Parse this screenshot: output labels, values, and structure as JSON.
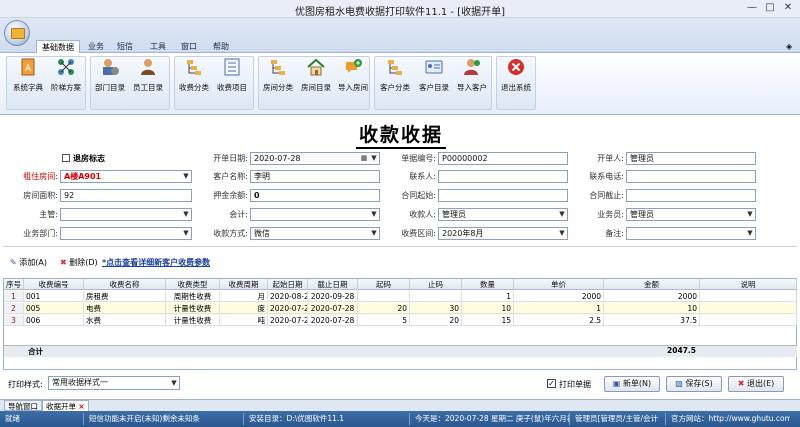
{
  "window": {
    "title": "优图房租水电费收据打印软件11.1 - [收据开单]"
  },
  "ribbon": {
    "tabs": [
      "基础数据",
      "业务",
      "短信",
      "工具",
      "窗口",
      "帮助"
    ],
    "buttons": [
      {
        "label": "系统字典",
        "icon": "dictionary-icon"
      },
      {
        "label": "阶梯方案",
        "icon": "ladder-scheme-icon"
      },
      {
        "label": "部门目录",
        "icon": "department-icon"
      },
      {
        "label": "员工目录",
        "icon": "employee-icon"
      },
      {
        "label": "收费分类",
        "icon": "fee-category-icon"
      },
      {
        "label": "收费项目",
        "icon": "fee-item-icon"
      },
      {
        "label": "房间分类",
        "icon": "room-category-icon"
      },
      {
        "label": "房间目录",
        "icon": "room-list-icon"
      },
      {
        "label": "导入房间",
        "icon": "import-room-icon"
      },
      {
        "label": "客户分类",
        "icon": "customer-category-icon"
      },
      {
        "label": "客户目录",
        "icon": "customer-list-icon"
      },
      {
        "label": "导入客户",
        "icon": "import-customer-icon"
      },
      {
        "label": "退出系统",
        "icon": "exit-icon"
      }
    ]
  },
  "form": {
    "title": "收款收据",
    "checkout_label": "退房标志",
    "fields": {
      "room_label": "租住房间:",
      "room_value": "A楼A901",
      "area_label": "房间面积:",
      "area_value": "92",
      "manager_label": "主管:",
      "manager_value": "",
      "dept_label": "业务部门:",
      "dept_value": "",
      "date_label": "开单日期:",
      "date_value": "2020-07-28",
      "customer_label": "客户名称:",
      "customer_value": "李明",
      "deposit_label": "押金余额:",
      "deposit_value": "0",
      "accountant_label": "会计:",
      "accountant_value": "",
      "paymethod_label": "收款方式:",
      "paymethod_value": "微信",
      "billno_label": "单据编号:",
      "billno_value": "P00000002",
      "contact_label": "联系人:",
      "contact_value": "",
      "contract_start_label": "合同起始:",
      "contract_start_value": "",
      "payee_label": "收款人:",
      "payee_value": "管理员",
      "period_label": "收费区间:",
      "period_value": "2020年8月",
      "opener_label": "开单人:",
      "opener_value": "管理员",
      "phone_label": "联系电话:",
      "phone_value": "",
      "contract_end_label": "合同截止:",
      "contract_end_value": "",
      "salesman_label": "业务员:",
      "salesman_value": "管理员",
      "remark_label": "备注:",
      "remark_value": ""
    }
  },
  "toolbar": {
    "add": "添加(A)",
    "delete": "删除(D)",
    "link": "*点击查看详细新客户收费参数"
  },
  "grid": {
    "headers": [
      "序号",
      "收费编号",
      "收费名称",
      "收费类型",
      "收费周期",
      "起始日期",
      "截止日期",
      "起码",
      "止码",
      "数量",
      "单价",
      "金额",
      "说明"
    ],
    "rows": [
      [
        "1",
        "001",
        "房租费",
        "周期性收费",
        "月",
        "2020-08-28",
        "2020-09-28",
        "",
        "",
        "1",
        "2000",
        "2000",
        ""
      ],
      [
        "2",
        "005",
        "电费",
        "计量性收费",
        "度",
        "2020-07-28",
        "2020-07-28",
        "20",
        "30",
        "10",
        "1",
        "10",
        ""
      ],
      [
        "3",
        "006",
        "水费",
        "计量性收费",
        "吨",
        "2020-07-28",
        "2020-07-28",
        "5",
        "20",
        "15",
        "2.5",
        "37.5",
        ""
      ]
    ],
    "total_label": "合计",
    "total_value": "2047.5"
  },
  "bottom": {
    "print_style_label": "打印样式:",
    "print_style_value": "常用收据样式一",
    "print_check_label": "打印单据",
    "new_button": "新单(N)",
    "save_button": "保存(S)",
    "exit_button": "退出(E)"
  },
  "bottom_tabs": [
    "导航窗口",
    "收据开单"
  ],
  "status": {
    "ready": "就绪",
    "sms": "短信功能未开启(未知)剩余未知条",
    "install": "安装目录：D:\\优图软件11.1",
    "today": "今天是：2020-07-28 星期二 庚子(鼠)年六月初九",
    "user": "管理员[管理员/主管/会计",
    "site": "官方网站：http://www.ghutu.com"
  }
}
